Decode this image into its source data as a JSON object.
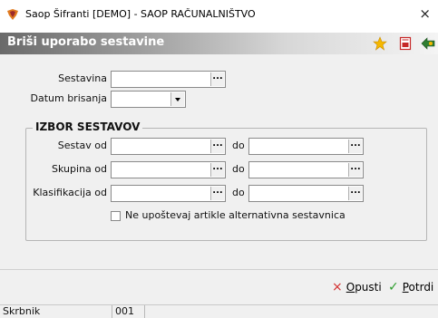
{
  "window": {
    "title": "Saop Šifranti [DEMO] - SAOP RAČUNALNIŠTVO",
    "close_glyph": "×"
  },
  "form": {
    "title": "Briši uporabo sestavine"
  },
  "header_icons": [
    "star-icon",
    "pdf-icon",
    "exit-icon"
  ],
  "fields": {
    "sestavina": {
      "label": "Sestavina",
      "value": "",
      "button_text": "..."
    },
    "datum": {
      "label": "Datum brisanja",
      "value": ""
    }
  },
  "izbor": {
    "title": "IZBOR SESTAVOV",
    "do_label": "do",
    "rows": [
      {
        "label": "Sestav od",
        "from": "",
        "to": "",
        "button_text": "..."
      },
      {
        "label": "Skupina od",
        "from": "",
        "to": "",
        "button_text": "..."
      },
      {
        "label": "Klasifikacija od",
        "from": "",
        "to": "",
        "button_text": "..."
      }
    ],
    "checkbox": {
      "label": "Ne upoštevaj artikle alternativna sestavnica",
      "checked": false
    }
  },
  "buttons": {
    "cancel": {
      "accel": "O",
      "rest": "pusti",
      "icon": "×",
      "color": "#d32f2f"
    },
    "confirm": {
      "accel": "P",
      "rest": "otrdi",
      "icon": "✓",
      "color": "#2e9e2e"
    }
  },
  "status": {
    "user_label": "Skrbnik",
    "code": "001"
  }
}
